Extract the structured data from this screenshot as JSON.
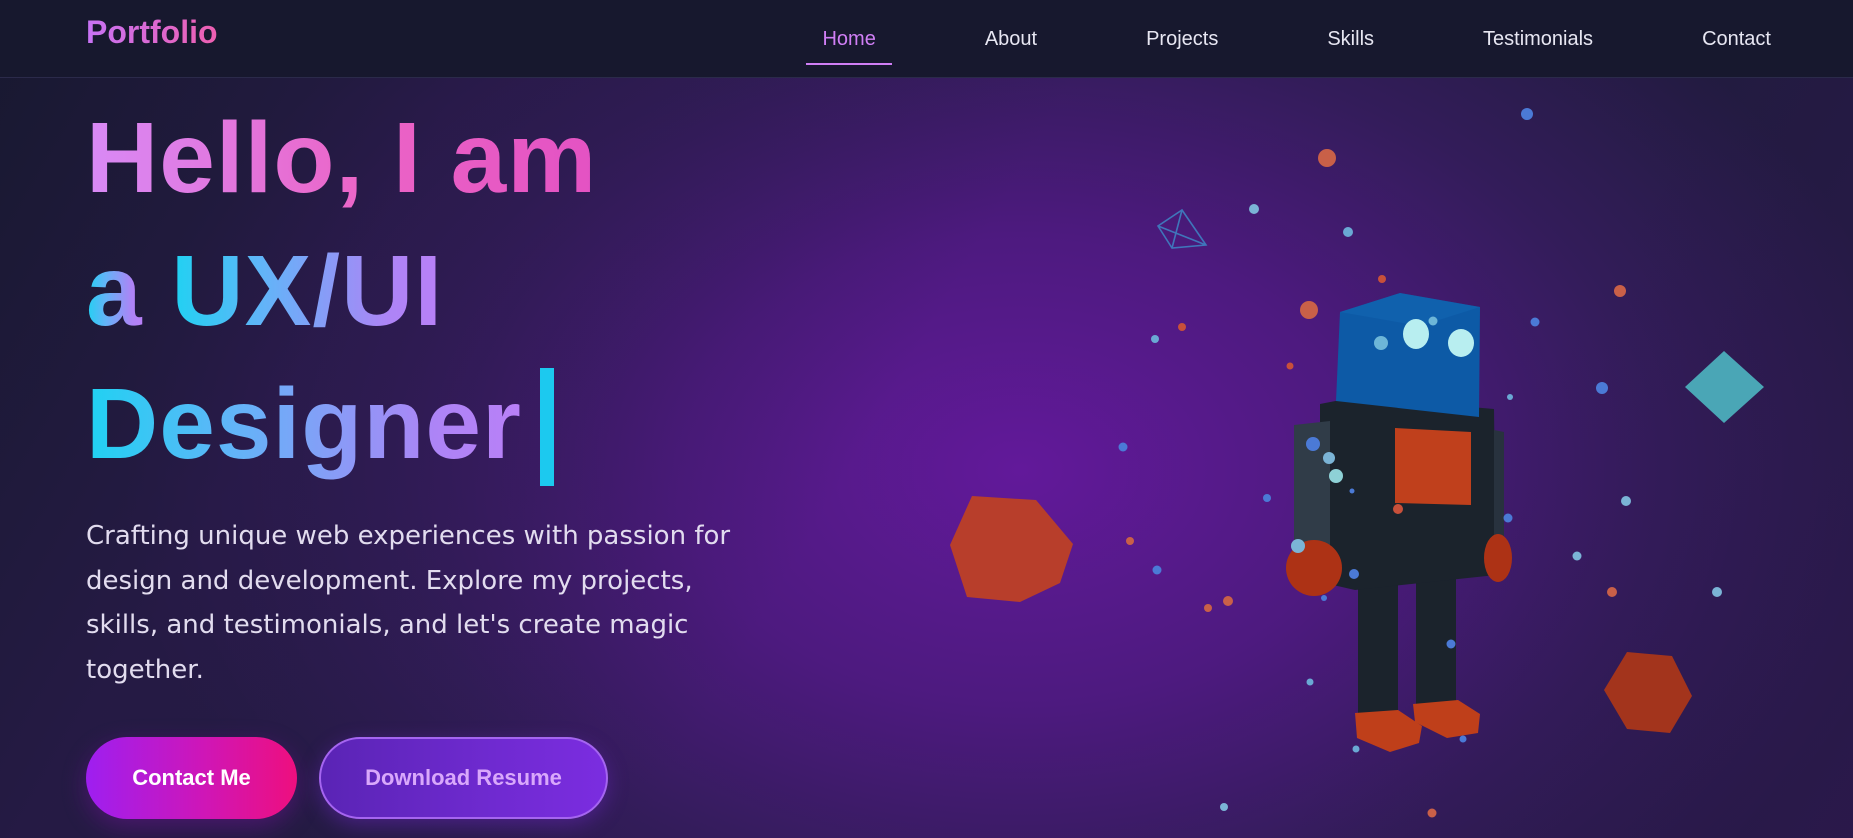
{
  "nav": {
    "logo": "Portfolio",
    "links": [
      {
        "label": "Home",
        "active": true
      },
      {
        "label": "About"
      },
      {
        "label": "Projects"
      },
      {
        "label": "Skills"
      },
      {
        "label": "Testimonials"
      },
      {
        "label": "Contact"
      }
    ]
  },
  "hero": {
    "greeting": "Hello, I am",
    "article": "a",
    "role_line1": "UX/UI",
    "role_line2": "Designer",
    "description": "Crafting unique web experiences with passion for design and development. Explore my projects, skills, and testimonials, and let's create magic together.",
    "primary_button": "Contact Me",
    "secondary_button": "Download Resume"
  },
  "illustration": {
    "subject": "low-poly robot",
    "icons": [
      "robot-icon",
      "pyramid-wireframe-icon",
      "diamond-icon",
      "hexagon-icon"
    ]
  },
  "colors": {
    "header_bg": "#17182e",
    "accent_pink": "#ee5fb0",
    "accent_purple": "#d07ef5",
    "accent_cyan": "#1cc9ef",
    "robot_blue": "#0d5aa6",
    "robot_orange": "#c0401c",
    "diamond_teal": "#4aa6b6"
  }
}
